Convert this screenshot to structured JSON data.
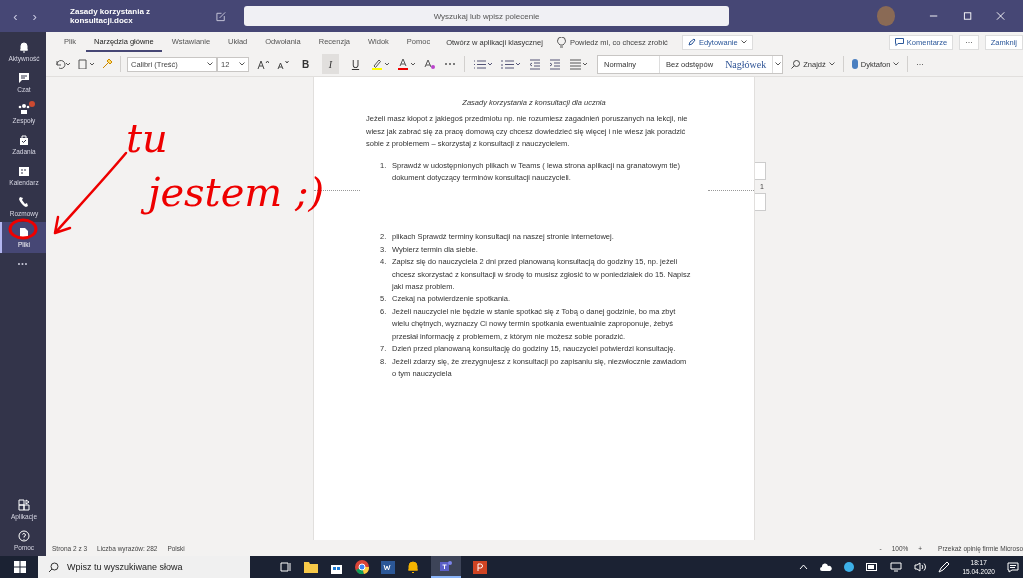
{
  "title_bar": {
    "back": "‹",
    "forward": "›",
    "title": "Zasady korzystania z konsultacji.docx",
    "search": {
      "placeholder": "Wyszukaj lub wpisz polecenie"
    }
  },
  "sidebar": {
    "items": [
      {
        "label": "Aktywność",
        "kind": "bell",
        "selected": false,
        "badge": false
      },
      {
        "label": "Czat",
        "kind": "chat",
        "selected": false,
        "badge": false
      },
      {
        "label": "Zespoły",
        "kind": "teams",
        "selected": false,
        "badge": true
      },
      {
        "label": "Zadania",
        "kind": "bag",
        "selected": false,
        "badge": false
      },
      {
        "label": "Kalendarz",
        "kind": "calendar",
        "selected": false,
        "badge": false
      },
      {
        "label": "Rozmowy",
        "kind": "phone",
        "selected": false,
        "badge": false
      },
      {
        "label": "Pliki",
        "kind": "file",
        "selected": true,
        "badge": false
      }
    ],
    "more": "•••",
    "bottom_items": [
      {
        "label": "Aplikacje",
        "kind": "apps"
      },
      {
        "label": "Pomoc",
        "kind": "help"
      }
    ]
  },
  "ribbon": {
    "tabs": [
      {
        "label": "Plik",
        "selected": false
      },
      {
        "label": "Narzędzia główne",
        "selected": true
      },
      {
        "label": "Wstawianie",
        "selected": false
      },
      {
        "label": "Układ",
        "selected": false
      },
      {
        "label": "Odwołania",
        "selected": false
      },
      {
        "label": "Recenzja",
        "selected": false
      },
      {
        "label": "Widok",
        "selected": false
      },
      {
        "label": "Pomoc",
        "selected": false
      }
    ],
    "open_desktop": "Otwórz w aplikacji klasycznej",
    "tell_me": {
      "placeholder": "Powiedz mi, co chcesz zrobić"
    },
    "mode": "Edytowanie",
    "comments": "Komentarze",
    "more": "···",
    "close": "Zamknij"
  },
  "toolbar": {
    "font": "Calibri (Treść)",
    "size": "12",
    "format_buttons": [
      {
        "label": "B",
        "kind": "bold",
        "on": false
      },
      {
        "label": "I",
        "kind": "italic",
        "on": true
      },
      {
        "label": "U",
        "kind": "underline",
        "on": false
      }
    ],
    "styles": [
      {
        "label": "Normalny",
        "kind": "normal"
      },
      {
        "label": "Bez odstępów",
        "kind": "normal"
      },
      {
        "label": "Nagłówek",
        "kind": "heading"
      }
    ],
    "find": "Znajdź",
    "dictate": "Dyktafon",
    "more": "···"
  },
  "document": {
    "title": "Zasady korzystania z konsultacji dla ucznia",
    "intro": "Jeżeli masz kłopot z jakiegoś przedmiotu np. nie rozumiesz zagadnień poruszanych na lekcji, nie wiesz jak zabrać się za pracę domową czy chcesz dowiedzieć się więcej i nie wiesz jak poradzić sobie z problemem – skorzystaj z konsultacji z nauczycielem.",
    "page_1_items": [
      {
        "number": "1.",
        "text": "Sprawdź  w udostępnionych plikach w Teams ( lewa strona aplikacji na granatowym tle) dokument dotyczący terminów konsultacji nauczycieli."
      }
    ],
    "page_number": "1",
    "page_2_items": [
      {
        "number": "2.",
        "text": "plikach Sprawdź terminy konsultacji na naszej stronie internetowej."
      },
      {
        "number": "3.",
        "text": "Wybierz termin dla siebie."
      },
      {
        "number": "4.",
        "text": "Zapisz się do nauczyciela 2 dni przed planowaną konsultacją do godziny 15, np. jeżeli chcesz skorzystać z konsultacji w środę to musisz zgłosić to w poniedziałek do 15. Napisz jaki masz problem."
      },
      {
        "number": "5.",
        "text": "Czekaj na potwierdzenie spotkania."
      },
      {
        "number": "6.",
        "text": "Jeżeli nauczyciel nie będzie w stanie spotkać się z Tobą o danej godzinie, bo ma zbyt wielu chętnych, wyznaczy Ci nowy termin spotkania ewentualnie zaproponuje, żebyś przesłał informację z problemem, z którym nie możesz sobie poradzić."
      },
      {
        "number": "7.",
        "text": "Dzień przed planowaną konsultację do godziny 15, nauczyciel potwierdzi konsultację."
      },
      {
        "number": "8.",
        "text": "Jeżeli zdarzy się, że zrezygnujesz z konsultacji po zapisaniu się, niezwłocznie zawiadom o tym nauczyciela"
      }
    ]
  },
  "status_bar": {
    "page": "Strona 2 z 3",
    "words": "Liczba wyrazów: 282",
    "language": "Polski",
    "zoom_out": "-",
    "zoom": "100%",
    "zoom_in": "+",
    "feedback": "Przekaż opinię firmie Microso"
  },
  "taskbar": {
    "search": {
      "placeholder": "Wpisz tu wyszukiwane słowa"
    },
    "time": "18:17",
    "date": "15.04.2020"
  },
  "annotation": {
    "lines": [
      "tu",
      "jestem ;)"
    ]
  }
}
